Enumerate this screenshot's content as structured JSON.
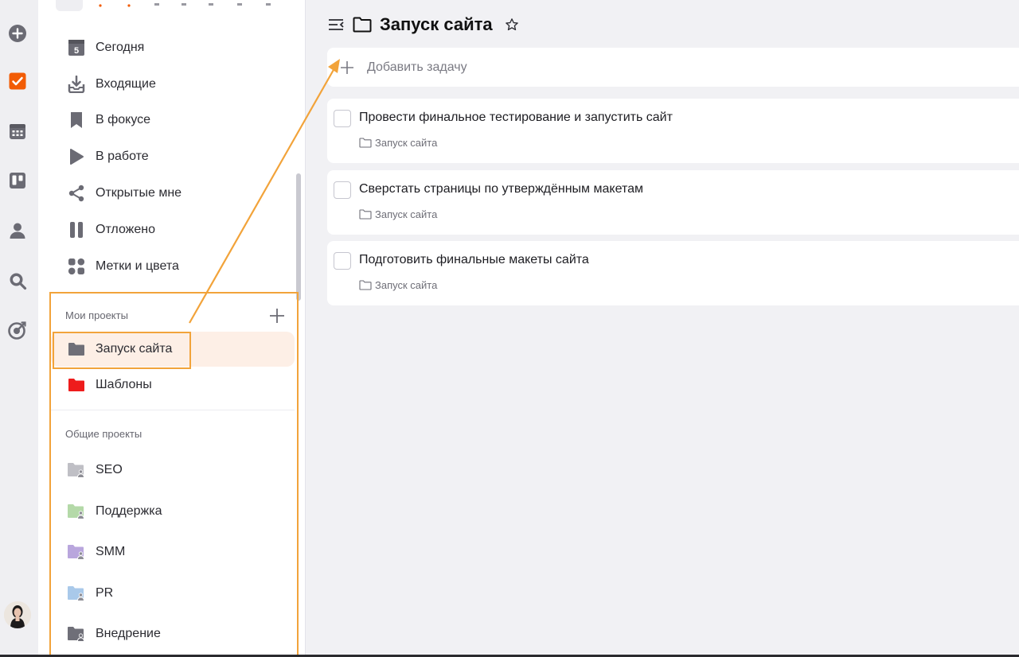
{
  "rail": {
    "items": [
      {
        "icon": "plus-circle-icon"
      },
      {
        "icon": "tasks-check-icon",
        "color": "#f25c05"
      },
      {
        "icon": "calendar-icon"
      },
      {
        "icon": "kanban-board-icon"
      },
      {
        "icon": "person-icon"
      },
      {
        "icon": "search-icon"
      },
      {
        "icon": "target-icon"
      }
    ],
    "avatar": "user-avatar"
  },
  "sidebar": {
    "nav": [
      {
        "label": "Сегодня",
        "icon": "calendar-day-icon",
        "day": "5"
      },
      {
        "label": "Входящие",
        "icon": "inbox-icon"
      },
      {
        "label": "В фокусе",
        "icon": "bookmark-icon"
      },
      {
        "label": "В работе",
        "icon": "play-icon"
      },
      {
        "label": "Открытые мне",
        "icon": "share-icon"
      },
      {
        "label": "Отложено",
        "icon": "pause-icon"
      },
      {
        "label": "Метки и цвета",
        "icon": "tags-grid-icon"
      }
    ],
    "my_projects": {
      "title": "Мои проекты",
      "items": [
        {
          "label": "Запуск сайта",
          "color": "#6f6f78",
          "active": true
        },
        {
          "label": "Шаблоны",
          "color": "#ee1c1c",
          "active": false
        }
      ]
    },
    "shared_projects": {
      "title": "Общие проекты",
      "items": [
        {
          "label": "SEO",
          "color": "#bfbfc5"
        },
        {
          "label": "Поддержка",
          "color": "#b4d9a8"
        },
        {
          "label": "SMM",
          "color": "#b9a6dd"
        },
        {
          "label": "PR",
          "color": "#a9c9ea"
        },
        {
          "label": "Внедрение",
          "color": "#6f6f78"
        }
      ]
    }
  },
  "main": {
    "title": "Запуск сайта",
    "add_task": "Добавить задачу",
    "tasks": [
      {
        "title": "Провести финальное тестирование и запустить сайт",
        "project": "Запуск сайта"
      },
      {
        "title": "Сверстать страницы по утверждённым макетам",
        "project": "Запуск сайта"
      },
      {
        "title": "Подготовить финальные макеты сайта",
        "project": "Запуск сайта"
      }
    ]
  },
  "colors": {
    "accent": "#f25c05",
    "annotation": "#f2a33a",
    "active_bg": "#fdefe6"
  }
}
